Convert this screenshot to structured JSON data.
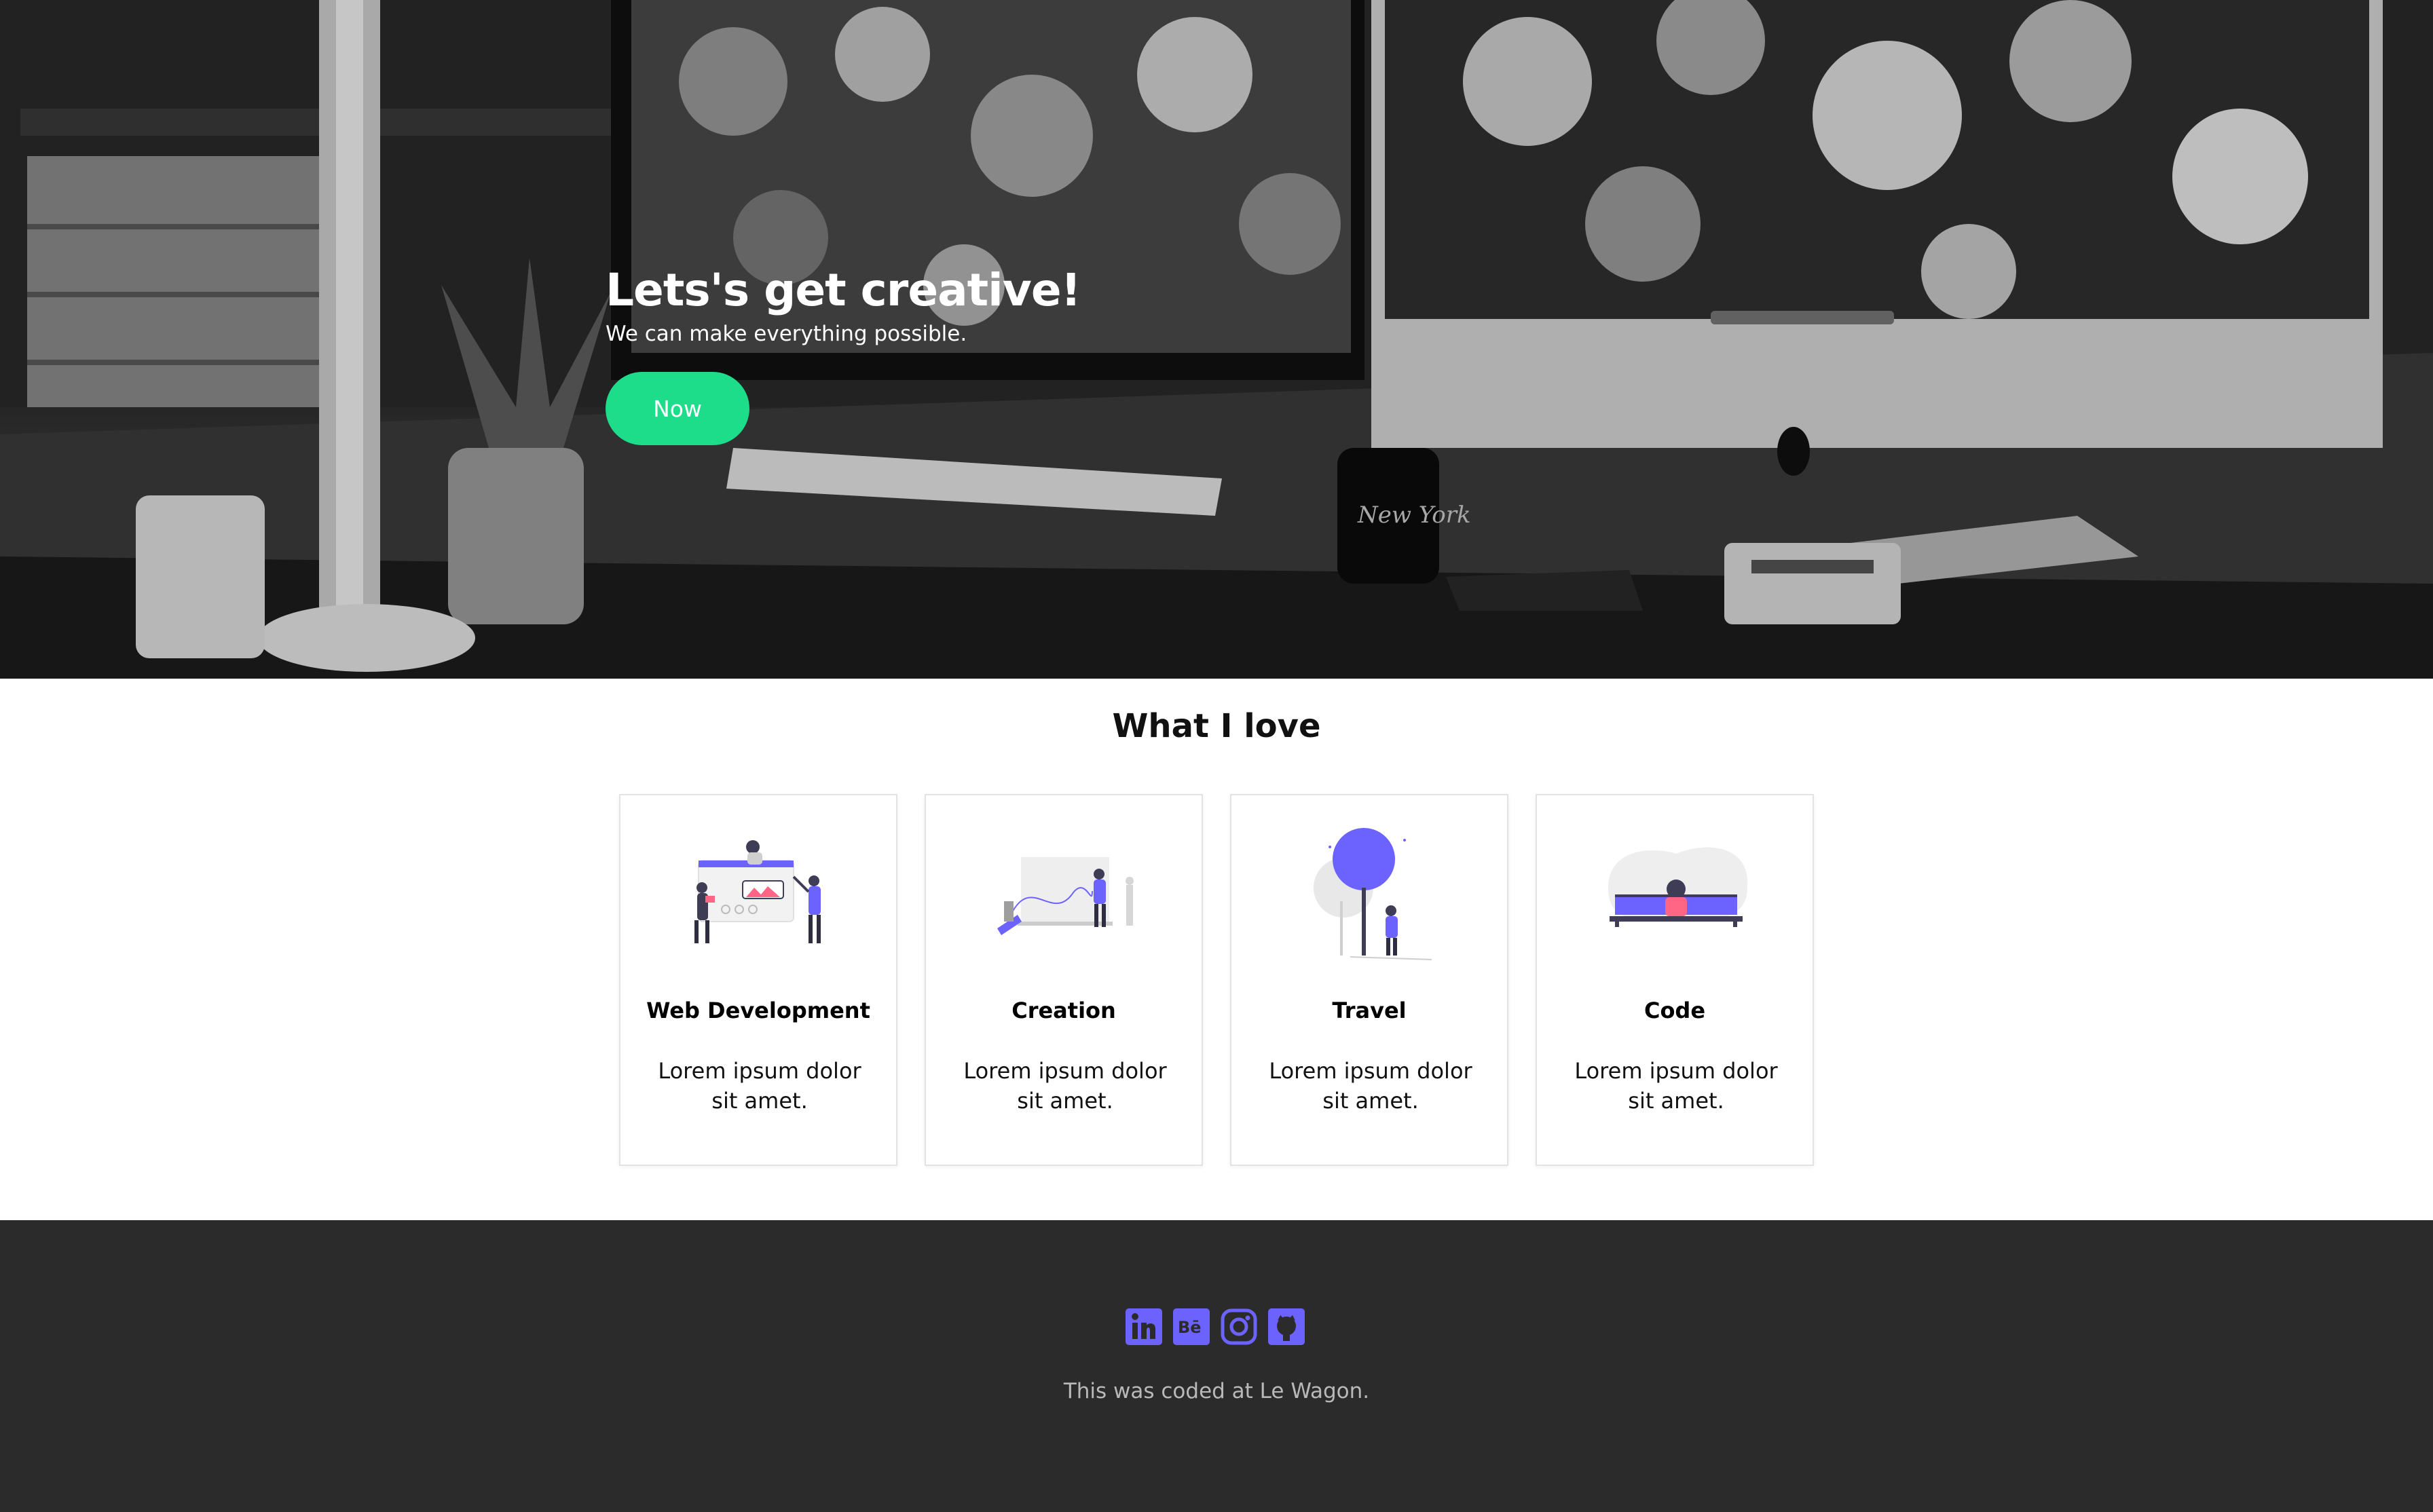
{
  "hero": {
    "title": "Lets's get creative!",
    "subtitle": "We can make everything possible.",
    "button_label": "Now",
    "photo_label": "New York"
  },
  "love": {
    "title": "What I love",
    "cards": [
      {
        "title": "Web Development",
        "text": "Lorem ipsum dolor sit amet.",
        "icon": "web-development-illustration"
      },
      {
        "title": "Creation",
        "text": "Lorem ipsum dolor sit amet.",
        "icon": "creation-illustration"
      },
      {
        "title": "Travel",
        "text": "Lorem ipsum dolor sit amet.",
        "icon": "travel-illustration"
      },
      {
        "title": "Code",
        "text": "Lorem ipsum dolor sit amet.",
        "icon": "code-illustration"
      }
    ]
  },
  "footer": {
    "socials": [
      "linkedin-icon",
      "behance-icon",
      "instagram-icon",
      "github-icon"
    ],
    "text": "This was coded at Le Wagon."
  },
  "colors": {
    "accent_green": "#1edd8a",
    "accent_purple": "#6c63ff",
    "footer_bg": "#2b2b2b",
    "footer_text": "#b9b9b9"
  }
}
